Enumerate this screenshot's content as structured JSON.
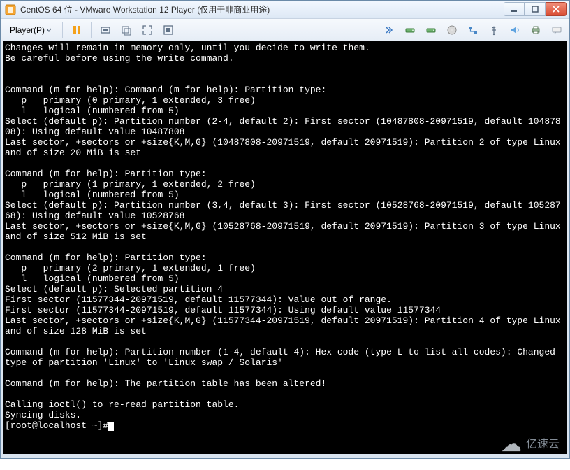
{
  "window": {
    "title": "CentOS 64 位 - VMware Workstation 12 Player (仅用于非商业用途)"
  },
  "toolbar": {
    "player_label": "Player(P)"
  },
  "watermark": {
    "text": "亿速云"
  },
  "terminal": {
    "lines": [
      "Changes will remain in memory only, until you decide to write them.",
      "Be careful before using the write command.",
      "",
      "",
      "Command (m for help): Command (m for help): Partition type:",
      "   p   primary (0 primary, 1 extended, 3 free)",
      "   l   logical (numbered from 5)",
      "Select (default p): Partition number (2-4, default 2): First sector (10487808-20971519, default 10487808): Using default value 10487808",
      "Last sector, +sectors or +size{K,M,G} (10487808-20971519, default 20971519): Partition 2 of type Linux and of size 20 MiB is set",
      "",
      "Command (m for help): Partition type:",
      "   p   primary (1 primary, 1 extended, 2 free)",
      "   l   logical (numbered from 5)",
      "Select (default p): Partition number (3,4, default 3): First sector (10528768-20971519, default 10528768): Using default value 10528768",
      "Last sector, +sectors or +size{K,M,G} (10528768-20971519, default 20971519): Partition 3 of type Linux and of size 512 MiB is set",
      "",
      "Command (m for help): Partition type:",
      "   p   primary (2 primary, 1 extended, 1 free)",
      "   l   logical (numbered from 5)",
      "Select (default p): Selected partition 4",
      "First sector (11577344-20971519, default 11577344): Value out of range.",
      "First sector (11577344-20971519, default 11577344): Using default value 11577344",
      "Last sector, +sectors or +size{K,M,G} (11577344-20971519, default 20971519): Partition 4 of type Linux and of size 128 MiB is set",
      "",
      "Command (m for help): Partition number (1-4, default 4): Hex code (type L to list all codes): Changed type of partition 'Linux' to 'Linux swap / Solaris'",
      "",
      "Command (m for help): The partition table has been altered!",
      "",
      "Calling ioctl() to re-read partition table.",
      "Syncing disks.",
      "[root@localhost ~]#"
    ]
  }
}
